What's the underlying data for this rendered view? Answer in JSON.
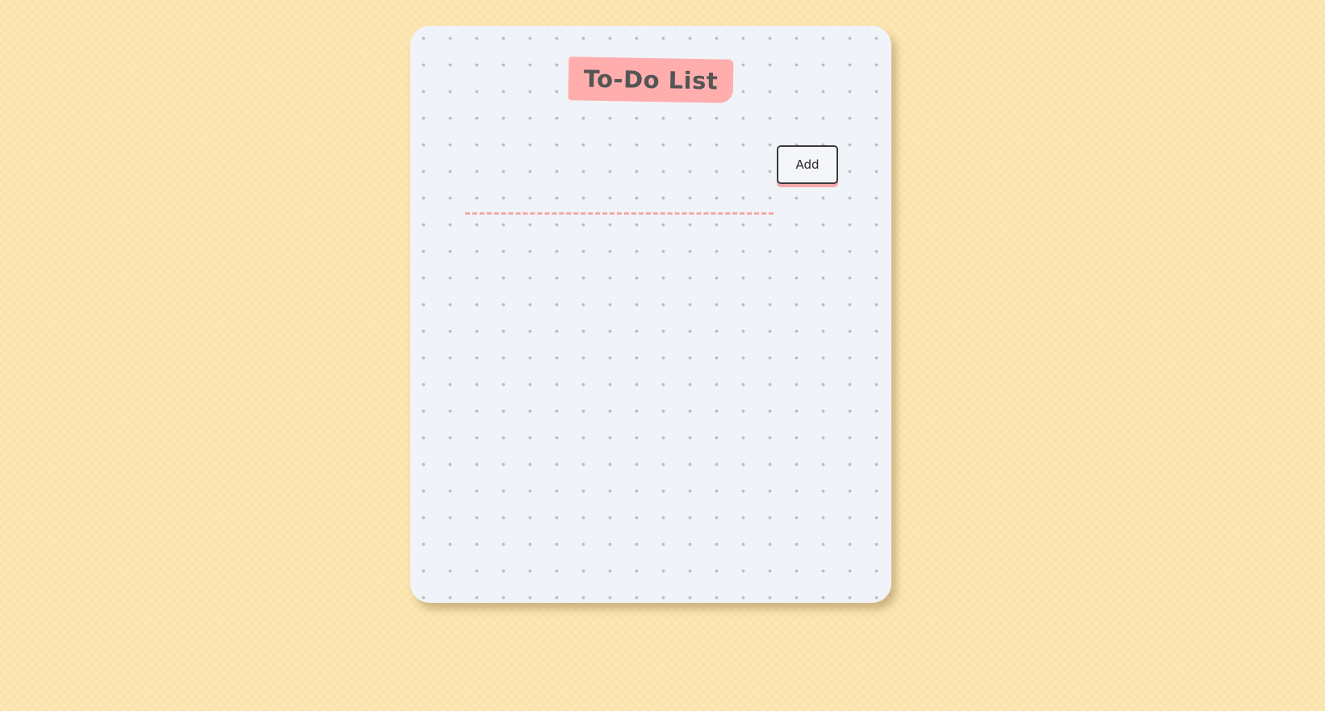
{
  "app": {
    "title": "To-Do List"
  },
  "form": {
    "input_value": "",
    "input_placeholder": "",
    "add_label": "Add"
  },
  "tasks": [],
  "colors": {
    "page_background": "#fde7b3",
    "card_background": "#f0f3f8",
    "title_tag": "#ffadad",
    "accent_dashed_line": "#f4a9a9",
    "button_border": "#3a3a3a"
  }
}
